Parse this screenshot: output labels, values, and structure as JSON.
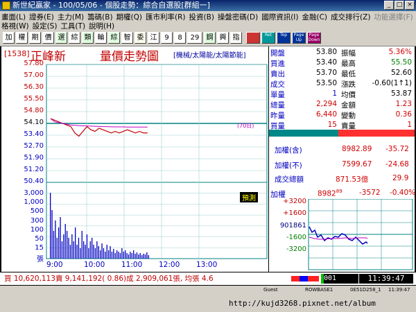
{
  "window": {
    "title": "新世紀贏家 - 100/05/06 - 個股走勢：綜合自選股[群組一]"
  },
  "menu": {
    "row1": [
      "畫面(L)",
      "證券(E)",
      "主力(M)",
      "籌碼(B)",
      "期權(Q)",
      "匯市利率(R)",
      "投資(B)",
      "操盤密碼(D)",
      "國際資訊(I)",
      "金融(C)",
      "成交排行(Z)",
      "功能選擇(F)"
    ],
    "row2": [
      "格視(W)",
      "設定(S)",
      "工具(T)",
      "說明(H)"
    ]
  },
  "toolbar": {
    "buttons": [
      "加",
      "權",
      "期",
      "價",
      "選",
      "綜",
      "類",
      "輪",
      "綜",
      "智",
      "委",
      "江",
      "9",
      "8",
      "29",
      "鋼",
      "興",
      "指"
    ],
    "icons": [
      "Ret",
      "Top",
      "Page Up",
      "Page Down"
    ]
  },
  "quote": {
    "code": "[1538]",
    "name": "正峰新",
    "chart_title": "量價走勢圖",
    "categories": "[機械/太陽能/太陽節能]",
    "open_label": "開盤",
    "open": "53.80",
    "amp_label": "振幅",
    "amp": "5.36%",
    "bid_label": "買進",
    "bid": "53.40",
    "high_label": "最高",
    "high": "55.50",
    "ask_label": "賣出",
    "ask": "53.70",
    "low_label": "最低",
    "low": "52.60",
    "last_label": "成交",
    "last": "53.50",
    "change_label": "漲跌",
    "change": "-0.60(1↑1)",
    "unit_label": "單量",
    "unit": "1",
    "avg_label": "均價",
    "avg": "53.87",
    "vol_label": "總量",
    "vol": "2,294",
    "amt_label": "金額",
    "amt": "1.23",
    "yvol_label": "昨量",
    "yvol": "6,440",
    "chg_label": "變動",
    "chg": "0.36",
    "bvol_label": "買量",
    "bvol": "15",
    "svol_label": "賣量",
    "svol": "1"
  },
  "index": {
    "incl_label": "加權(含)",
    "incl": "8982.89",
    "incl_chg": "-35.72",
    "excl_label": "加權(不)",
    "excl": "7599.67",
    "excl_chg": "-24.68",
    "total_label": "成交總額",
    "total": "871.53億",
    "total_chg": "29.9",
    "mini_label": "加權",
    "mini_value": "8982",
    "mini_value_sub": "89",
    "mini_chg": "-3572",
    "mini_pct": "-0.40%",
    "mini_axis": [
      "+3200",
      "+1600",
      "901861",
      "-1600",
      "-3200"
    ]
  },
  "chart": {
    "y_labels": [
      "57.80",
      "57.00",
      "56.30",
      "55.50",
      "54.80",
      "54.10",
      "53.40",
      "52.70",
      "51.90",
      "51.20",
      "50.40"
    ],
    "vol_labels": [
      "3,000",
      "1,000",
      "500",
      "300",
      "100",
      "50",
      "15",
      "張"
    ],
    "x_labels": [
      "9:00",
      "10:00",
      "11:00",
      "12:00",
      "13:00"
    ],
    "ma_tag": "(70日)",
    "forecast_btn": "預測"
  },
  "chart_data": {
    "type": "line",
    "x_ticks": [
      "9:00",
      "10:00",
      "11:00",
      "12:00",
      "13:00"
    ],
    "ylim": [
      50.4,
      57.8
    ],
    "series": [
      {
        "values": [
          54.4,
          54.3,
          54.2,
          54.1,
          54.0,
          53.9,
          53.5,
          53.3,
          53.6,
          53.9,
          53.7,
          53.6,
          53.8,
          53.7,
          53.6,
          53.5,
          53.6,
          53.5,
          53.6,
          53.7,
          53.6,
          53.5,
          53.6,
          53.5,
          53.5
        ]
      },
      {
        "values": [
          54.4,
          54.2,
          54.15,
          54.1,
          54.05,
          54.0,
          53.98,
          53.96,
          53.95,
          53.94,
          53.93,
          53.92,
          53.91,
          53.9,
          53.9,
          53.89,
          53.88,
          53.88,
          53.88,
          53.87,
          53.87,
          53.87,
          53.87,
          53.87,
          53.87
        ]
      }
    ]
  },
  "status": {
    "text": "買 10,620,113賣 9,141,192( 0.86)成 2,909,061張, 均張 4.6"
  },
  "bottom": {
    "code_input": "001",
    "time": "11:39:47",
    "guest": "Guest",
    "server": "ROWBASE1",
    "build": "0E51D258_1",
    "clock": "11:39:47",
    "footer_url": "http://kujd3268.pixnet.net/album"
  }
}
